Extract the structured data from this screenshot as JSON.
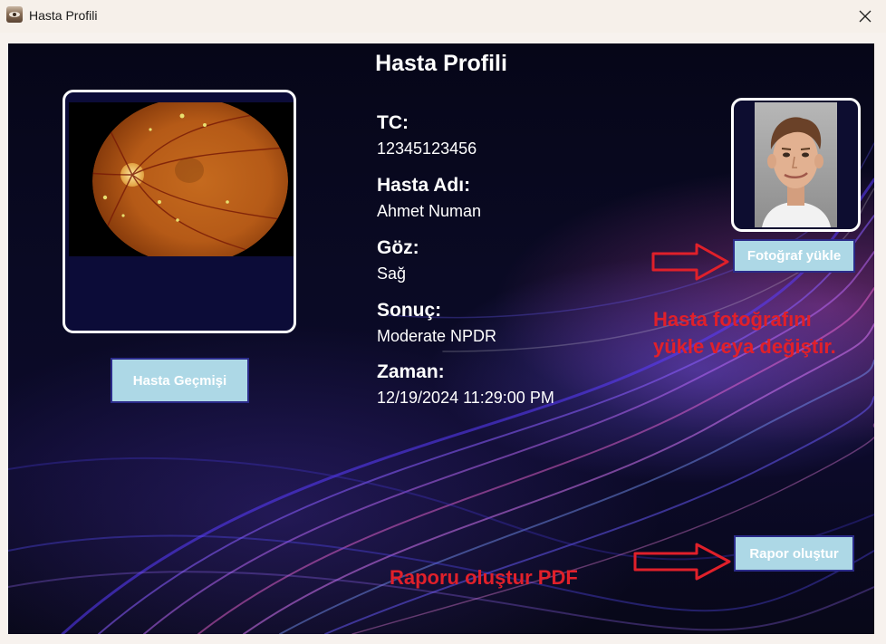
{
  "window": {
    "title": "Hasta Profili",
    "icon": "eye-app-icon",
    "close_icon": "close-icon"
  },
  "page": {
    "title": "Hasta Profili"
  },
  "patient": {
    "tc_label": "TC:",
    "tc_value": "12345123456",
    "name_label": "Hasta Adı:",
    "name_value": "Ahmet Numan",
    "eye_label": "Göz:",
    "eye_value": "Sağ",
    "result_label": "Sonuç:",
    "result_value": "Moderate NPDR",
    "time_label": "Zaman:",
    "time_value": "12/19/2024 11:29:00 PM"
  },
  "buttons": {
    "history": "Hasta Geçmişi",
    "upload_photo": "Fotoğraf yükle",
    "create_report": "Rapor oluştur"
  },
  "annotations": {
    "photo_note": "Hasta fotoğrafını yükle veya değiştir.",
    "report_note": "Raporu oluştur PDF",
    "color": "#e0202a"
  },
  "colors": {
    "button_bg": "#add8e6",
    "button_border": "#2b2b8a",
    "panel_bg": "#080820"
  }
}
